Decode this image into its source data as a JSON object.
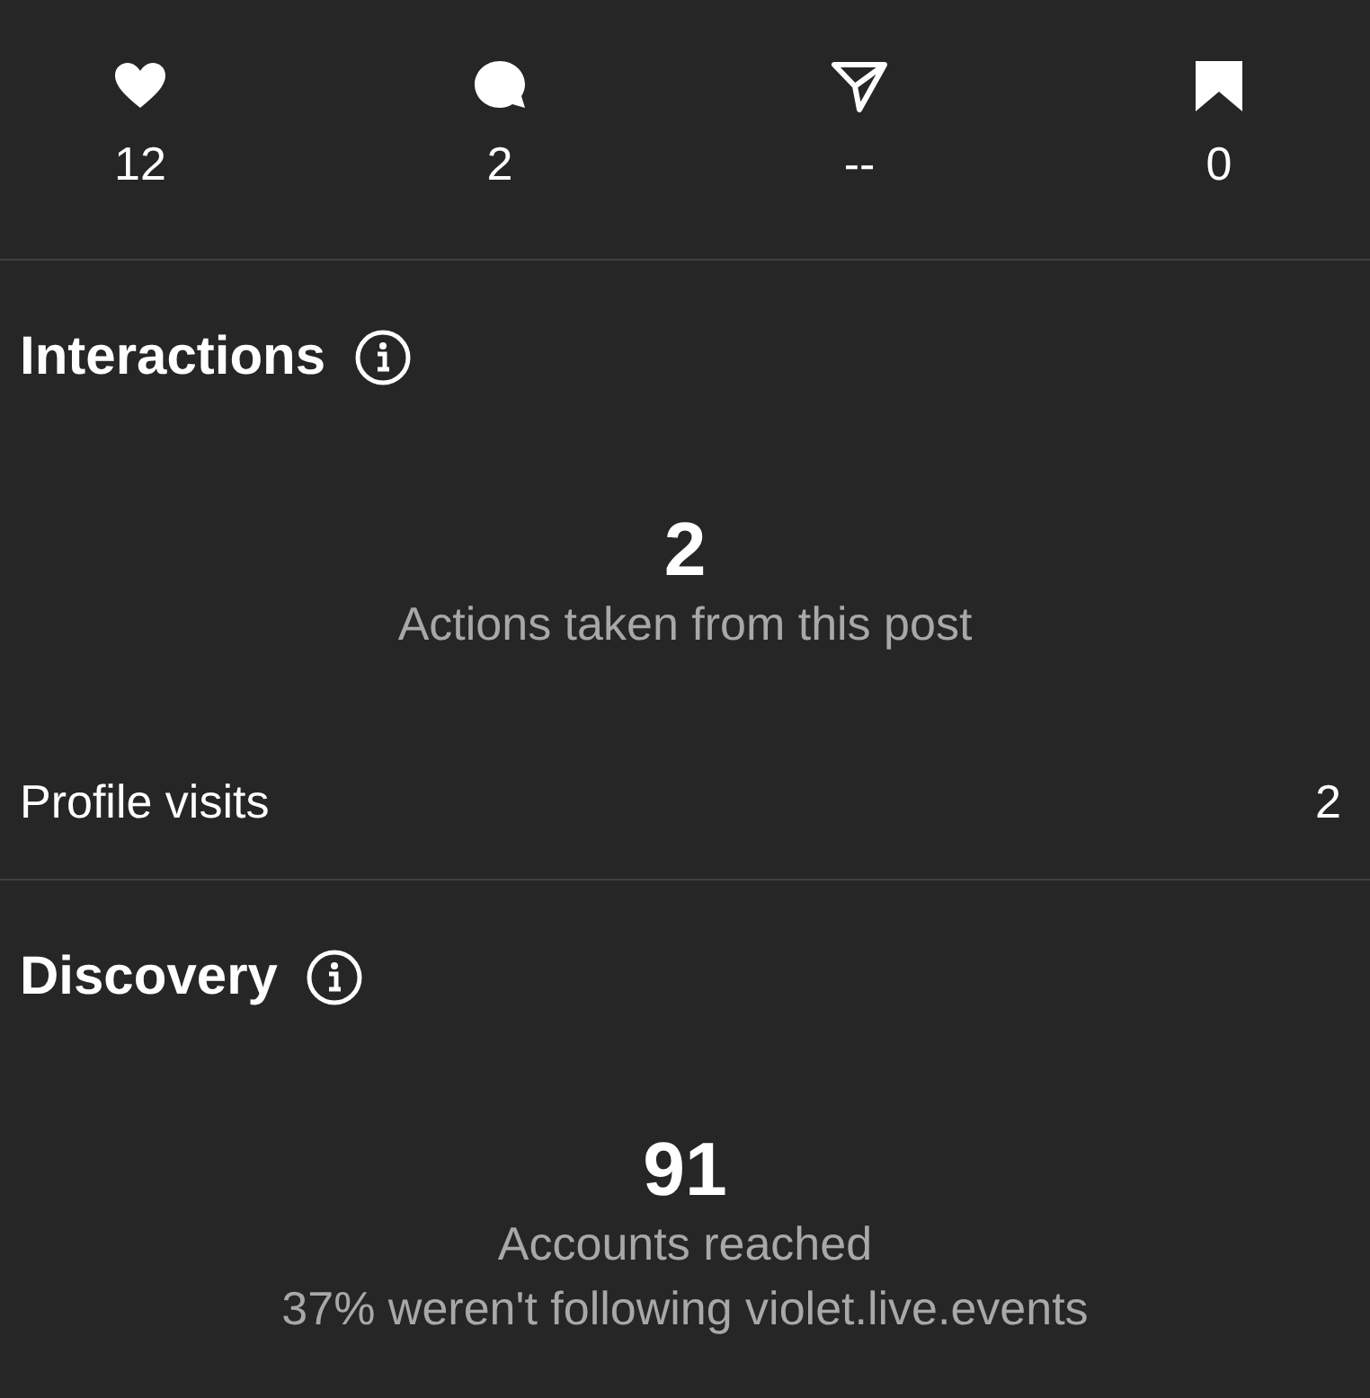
{
  "stats": [
    {
      "kind": "likes",
      "value": "12"
    },
    {
      "kind": "comments",
      "value": "2"
    },
    {
      "kind": "shares",
      "value": "--"
    },
    {
      "kind": "saves",
      "value": "0"
    }
  ],
  "sections": [
    {
      "title": "Interactions",
      "big_number": "2",
      "caption_lines": [
        "Actions taken from this post"
      ],
      "rows": [
        {
          "label": "Profile visits",
          "value": "2"
        }
      ]
    },
    {
      "title": "Discovery",
      "big_number": "91",
      "caption_lines": [
        "Accounts reached",
        "37% weren't following violet.live.events"
      ]
    }
  ]
}
